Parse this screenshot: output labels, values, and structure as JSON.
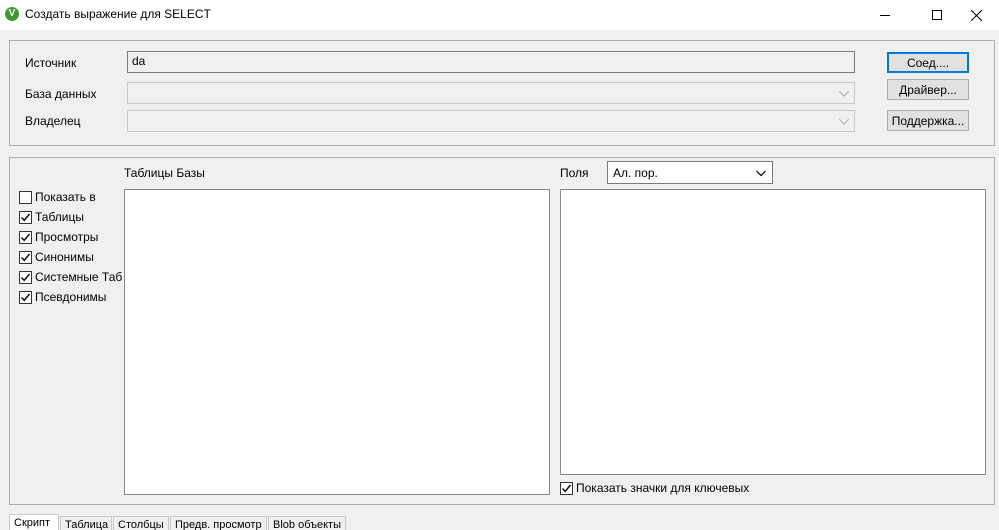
{
  "window": {
    "title": "Создать выражение для SELECT",
    "icon": "qlik-v-icon",
    "icon_letter": "V",
    "icon_color": "#3f9c35"
  },
  "connection": {
    "source_label": "Источник",
    "source_value": "da",
    "database_label": "База данных",
    "database_value": "",
    "owner_label": "Владелец",
    "owner_value": "",
    "connect_button": "Соед....",
    "driver_button": "Драйвер...",
    "support_button": "Поддержка..."
  },
  "tables": {
    "header": "Таблицы Базы",
    "options": [
      {
        "label": "Показать в",
        "checked": false
      },
      {
        "label": "Таблицы",
        "checked": true
      },
      {
        "label": "Просмотры",
        "checked": true
      },
      {
        "label": "Синонимы",
        "checked": true
      },
      {
        "label": "Системные Таб",
        "checked": true
      },
      {
        "label": "Псевдонимы",
        "checked": true
      }
    ]
  },
  "fields": {
    "header": "Поля",
    "sort_value": "Ал. пор.",
    "show_keys_label": "Показать значки для ключевых",
    "show_keys_checked": true
  },
  "tabs": [
    {
      "label": "Скрипт",
      "active": true
    },
    {
      "label": "Таблица",
      "active": false
    },
    {
      "label": "Столбцы",
      "active": false
    },
    {
      "label": "Предв. просмотр",
      "active": false
    },
    {
      "label": "Blob объекты",
      "active": false
    }
  ],
  "colors": {
    "accent": "#0078d7",
    "background": "#f0f0f0"
  }
}
